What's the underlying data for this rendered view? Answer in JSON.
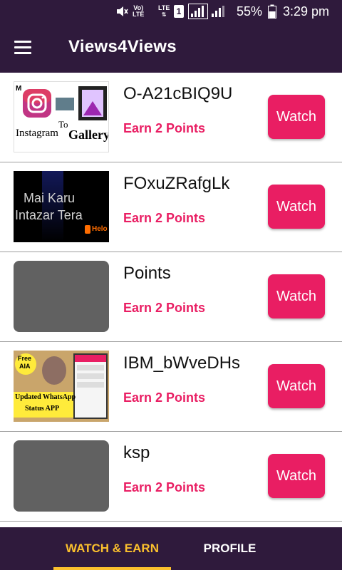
{
  "status_bar": {
    "volte": "Vo)",
    "lte_small": "LTE",
    "lte_top": "LTE",
    "sim": "1",
    "battery": "55%",
    "time": "3:29 pm"
  },
  "app_bar": {
    "title": "Views4Views",
    "menu_icon": "hamburger-menu-icon"
  },
  "videos": [
    {
      "title": "O-A21cBIQ9U",
      "earn": "Earn 2 Points",
      "watch": "Watch",
      "thumbnail": {
        "type": "image",
        "line1": "Instagram",
        "line2": "To",
        "line3": "Gallery",
        "corner": "M"
      }
    },
    {
      "title": "FOxuZRafgLk",
      "earn": "Earn 2 Points",
      "watch": "Watch",
      "thumbnail": {
        "type": "image",
        "line1": "Mai Karu",
        "line2": "Intazar Tera",
        "badge": "Helo"
      }
    },
    {
      "title": "Points",
      "earn": "Earn 2 Points",
      "watch": "Watch",
      "thumbnail": {
        "type": "placeholder"
      }
    },
    {
      "title": "IBM_bWveDHs",
      "earn": "Earn 2 Points",
      "watch": "Watch",
      "thumbnail": {
        "type": "image",
        "line1": "Free",
        "line2": "AIA",
        "line3": "Updated WhatsApp",
        "line4": "Status APP"
      }
    },
    {
      "title": "ksp",
      "earn": "Earn 2 Points",
      "watch": "Watch",
      "thumbnail": {
        "type": "placeholder"
      }
    }
  ],
  "bottom_nav": {
    "tabs": [
      {
        "label": "WATCH & EARN",
        "active": true
      },
      {
        "label": "PROFILE",
        "active": false
      }
    ]
  },
  "colors": {
    "primary_dark": "#2f1a3c",
    "accent": "#e91e63",
    "active_tab": "#fbc02d",
    "placeholder": "#616161"
  }
}
